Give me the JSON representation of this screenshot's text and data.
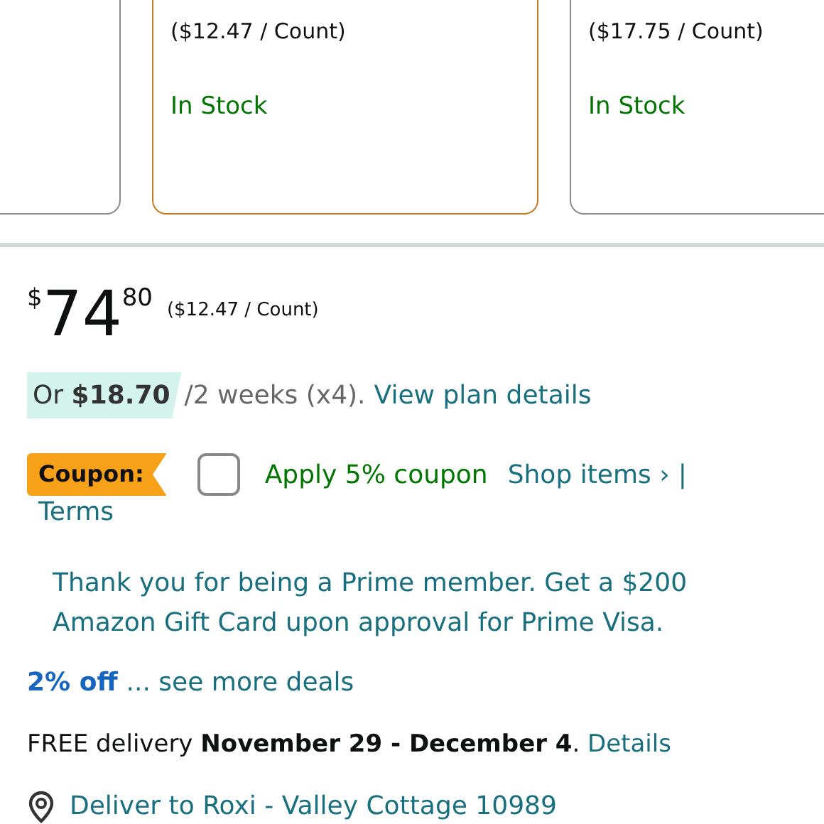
{
  "options": [
    {
      "selected": false
    },
    {
      "selected": true,
      "unit_price": "($12.47 / Count)",
      "stock": "In Stock"
    },
    {
      "selected": false,
      "unit_price": "($17.75 / Count)",
      "stock": "In Stock"
    }
  ],
  "price": {
    "currency": "$",
    "whole": "74",
    "fraction": "80",
    "unit_price": "($12.47 / Count)"
  },
  "installment": {
    "amount": "Or **$18.70**",
    "terms": "/2 weeks (x4).",
    "link": "View plan details"
  },
  "coupon": {
    "badge": "Coupon:",
    "checked": false,
    "label": "Apply 5% coupon",
    "shop_link": "Shop items ›",
    "separator": "|",
    "terms_link": "Terms"
  },
  "prime_offer": "Thank you for being a Prime member. Get a $200 Amazon Gift Card upon approval for Prime Visa.",
  "deals": {
    "discount": "2% off",
    "link": "... see more deals"
  },
  "delivery": {
    "text": "FREE delivery **November 29 - December 4**.",
    "link": "Details"
  },
  "location": "Deliver to Roxi - Valley Cottage 10989"
}
